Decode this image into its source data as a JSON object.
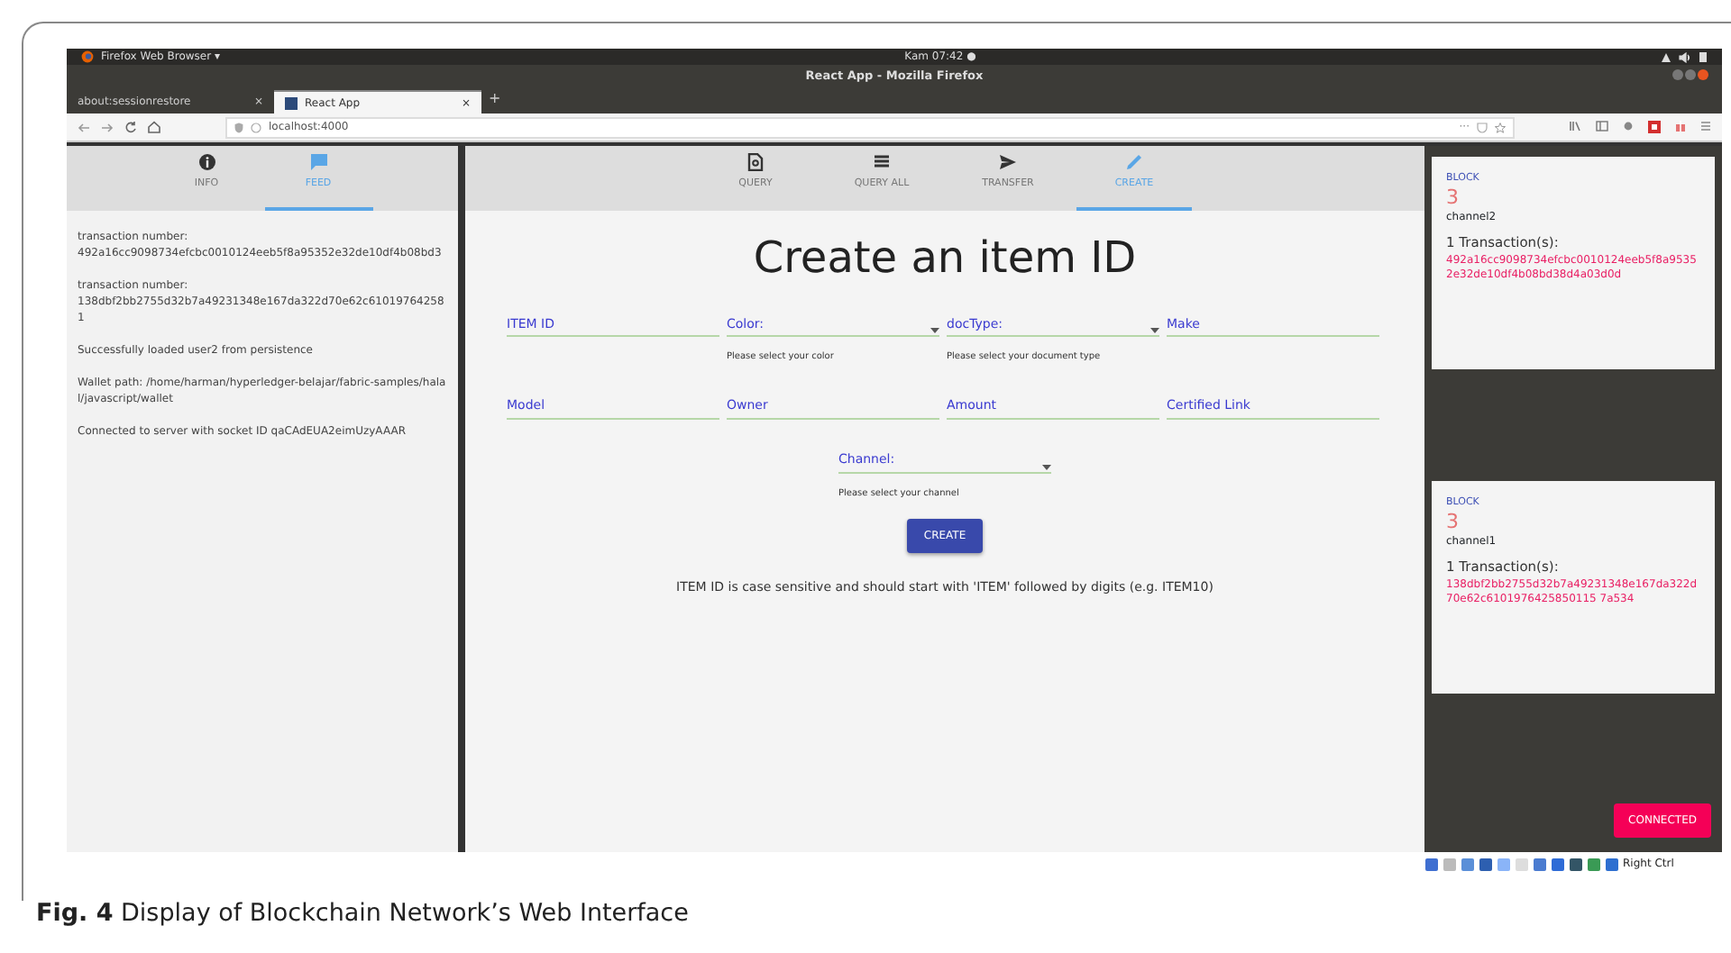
{
  "browser": {
    "app_menu": "Firefox Web Browser ▾",
    "clock": "Kam 07:42 ●",
    "window_title": "React App - Mozilla Firefox",
    "tabs": [
      {
        "label": "about:sessionrestore",
        "close": "×",
        "selected": false
      },
      {
        "label": "React App",
        "close": "×",
        "selected": true
      }
    ],
    "new_tab": "+",
    "url": "localhost:4000",
    "page_actions": "···"
  },
  "sidebar": {
    "tabs": [
      {
        "label": "INFO",
        "kind": "info",
        "selected": false
      },
      {
        "label": "FEED",
        "kind": "feed",
        "selected": true
      }
    ],
    "feed": [
      {
        "kind": "transaction",
        "label": "transaction number:",
        "value": "492a16cc9098734efcbc0010124eeb5f8a95352e32de10df4b08bd3"
      },
      {
        "kind": "transaction",
        "label": "transaction number:",
        "value": "138dbf2bb2755d32b7a49231348e167da322d70e62c610197642581"
      },
      {
        "kind": "message",
        "text": "Successfully loaded user2 from persistence"
      },
      {
        "kind": "message",
        "text": "Wallet path: /home/harman/hyperledger-belajar/fabric-samples/halal/javascript/wallet"
      },
      {
        "kind": "message",
        "text": "Connected to server with socket ID qaCAdEUA2eimUzyAAAR"
      }
    ]
  },
  "main": {
    "tabs": [
      {
        "label": "QUERY",
        "kind": "doc",
        "selected": false
      },
      {
        "label": "QUERY ALL",
        "kind": "list",
        "selected": false
      },
      {
        "label": "TRANSFER",
        "kind": "send",
        "selected": false
      },
      {
        "label": "CREATE",
        "kind": "pencil",
        "selected": true
      }
    ],
    "heading": "Create an item ID",
    "fields": [
      {
        "kind": "text",
        "label": "ITEM ID"
      },
      {
        "kind": "select",
        "label": "Color:",
        "helper": "Please select your color"
      },
      {
        "kind": "select",
        "label": "docType:",
        "helper": "Please select your document type"
      },
      {
        "kind": "text",
        "label": "Make"
      },
      {
        "kind": "text",
        "label": "Model"
      },
      {
        "kind": "text",
        "label": "Owner"
      },
      {
        "kind": "text",
        "label": "Amount"
      },
      {
        "kind": "text",
        "label": "Certified Link"
      }
    ],
    "channel": {
      "kind": "select",
      "label": "Channel:",
      "helper": "Please select your channel"
    },
    "button": "CREATE",
    "note": "ITEM ID is case sensitive and should start with 'ITEM' followed by digits (e.g. ITEM10)"
  },
  "blocks": [
    {
      "label": "BLOCK",
      "number": "3",
      "channel": "channel2",
      "count": "1 Transaction(s):",
      "hash": "492a16cc9098734efcbc0010124eeb5f8a95352e32de10df4b08bd38d4a03d0d"
    },
    {
      "label": "BLOCK",
      "number": "3",
      "channel": "channel1",
      "count": "1 Transaction(s):",
      "hash": "138dbf2bb2755d32b7a49231348e167da322d70e62c6101976425850115 7a534"
    }
  ],
  "status": "CONNECTED",
  "tray": "Right Ctrl",
  "caption": {
    "label": "Fig. 4",
    "text": "Display of Blockchain Network’s Web Interface"
  }
}
